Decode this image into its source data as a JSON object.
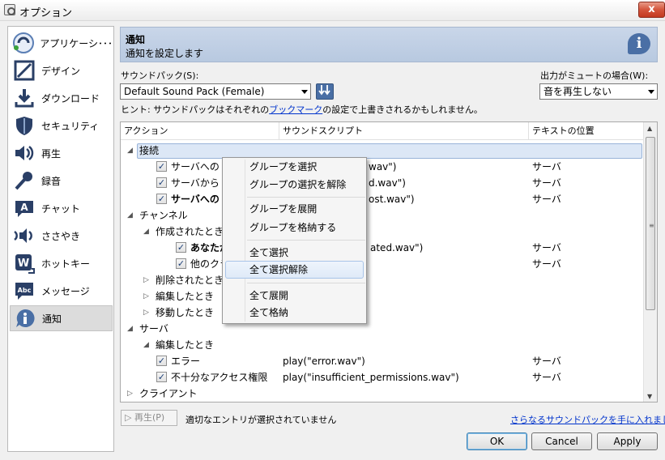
{
  "window": {
    "title": "オプション",
    "close": "x"
  },
  "sidebar": {
    "items": [
      {
        "label": "アプリケーシ･･･",
        "icon": "teamspeak-logo-icon",
        "color": "#5b7fb5"
      },
      {
        "label": "デザイン",
        "icon": "design-icon",
        "color": "#2a3f66"
      },
      {
        "label": "ダウンロード",
        "icon": "download-icon",
        "color": "#2a3f66"
      },
      {
        "label": "セキュリティ",
        "icon": "shield-icon",
        "color": "#2a3f66"
      },
      {
        "label": "再生",
        "icon": "speaker-icon",
        "color": "#2a3f66"
      },
      {
        "label": "録音",
        "icon": "microphone-icon",
        "color": "#2a3f66"
      },
      {
        "label": "チャット",
        "icon": "chat-icon",
        "color": "#2a3f66"
      },
      {
        "label": "ささやき",
        "icon": "whisper-icon",
        "color": "#2a3f66"
      },
      {
        "label": "ホットキー",
        "icon": "hotkey-icon",
        "color": "#2a3f66"
      },
      {
        "label": "メッセージ",
        "icon": "message-icon",
        "color": "#2a3f66"
      },
      {
        "label": "通知",
        "icon": "info-icon",
        "color": "#4a6fa5",
        "selected": true
      }
    ]
  },
  "header": {
    "title": "通知",
    "subtitle": "通知を設定します",
    "icon_glyph": "i"
  },
  "sound_pack": {
    "label": "サウンドパック(S):",
    "value": "Default Sound Pack (Female)"
  },
  "mute_output": {
    "label": "出力がミュートの場合(W):",
    "value": "音を再生しない"
  },
  "hint": {
    "prefix": "ヒント: サウンドパックはそれぞれの",
    "link": "ブックマーク",
    "suffix": "の設定で上書きされるかもしれません。"
  },
  "tree": {
    "columns": [
      "アクション",
      "サウンドスクリプト",
      "テキストの位置"
    ],
    "rows": [
      {
        "level": 0,
        "expander": "◢",
        "label": "接続",
        "script": "",
        "pos": "",
        "selected": true
      },
      {
        "level": 2,
        "checkbox": true,
        "label": "サーバへの",
        "bold": false,
        "script": "wav\")",
        "pos": "サーバ"
      },
      {
        "level": 2,
        "checkbox": true,
        "label": "サーバから",
        "bold": false,
        "script": "d.wav\")",
        "pos": "サーバ"
      },
      {
        "level": 2,
        "checkbox": true,
        "label": "サーバへの",
        "bold": true,
        "script": "ost.wav\")",
        "pos": "サーバ"
      },
      {
        "level": 0,
        "expander": "◢",
        "label": "チャンネル",
        "script": "",
        "pos": ""
      },
      {
        "level": 1,
        "expander": "◢",
        "label": "作成されたとき",
        "script": "",
        "pos": ""
      },
      {
        "level": 3,
        "checkbox": true,
        "label": "あなたが",
        "bold": true,
        "script": "ated.wav\")",
        "pos": "サーバ"
      },
      {
        "level": 3,
        "checkbox": true,
        "label": "他のクラ",
        "bold": false,
        "script": "",
        "pos": "サーバ"
      },
      {
        "level": 1,
        "expander": "▷",
        "label": "削除されたとき",
        "script": "",
        "pos": ""
      },
      {
        "level": 1,
        "expander": "▷",
        "label": "編集したとき",
        "script": "",
        "pos": ""
      },
      {
        "level": 1,
        "expander": "▷",
        "label": "移動したとき",
        "script": "",
        "pos": ""
      },
      {
        "level": 0,
        "expander": "◢",
        "label": "サーバ",
        "script": "",
        "pos": ""
      },
      {
        "level": 1,
        "expander": "◢",
        "label": "編集したとき",
        "script": "",
        "pos": ""
      },
      {
        "level": 2,
        "checkbox": true,
        "label": "エラー",
        "bold": false,
        "script": "play(\"error.wav\")",
        "pos": "サーバ"
      },
      {
        "level": 2,
        "checkbox": true,
        "label": "不十分なアクセス権限",
        "bold": false,
        "script": "play(\"insufficient_permissions.wav\")",
        "pos": "サーバ"
      },
      {
        "level": 0,
        "expander": "▷",
        "label": "クライアント",
        "script": "",
        "pos": ""
      }
    ]
  },
  "context_menu": {
    "items": [
      "グループを選択",
      "グループの選択を解除",
      "グループを展開",
      "グループを格納する",
      "全て選択",
      "全て選択解除",
      "全て展開",
      "全て格納"
    ],
    "highlighted": "全て選択解除"
  },
  "bottom": {
    "play_label": "再生(P)",
    "status": "適切なエントリが選択されていません",
    "more_link": "さらなるサウンドパックを手に入れましょう",
    "ok": "OK",
    "cancel": "Cancel",
    "apply": "Apply"
  },
  "colors": {
    "accent": "#4a6fa5",
    "header_bg": "#c9d6e9",
    "selection": "#dce7f6"
  }
}
